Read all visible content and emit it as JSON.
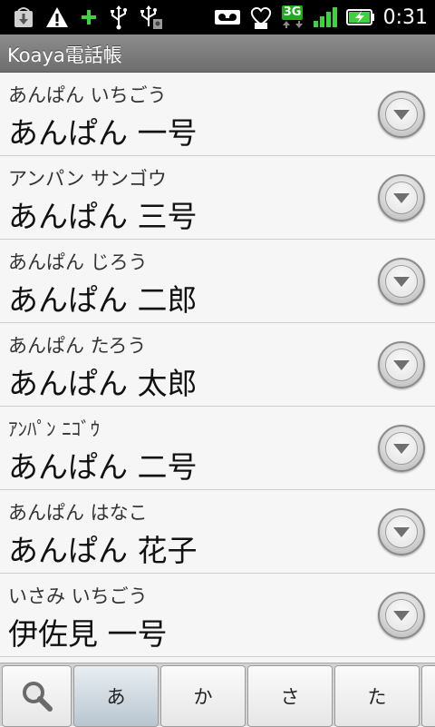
{
  "status_bar": {
    "left_icons": [
      "download-notification-icon",
      "warning-icon",
      "plus-icon",
      "usb-icon",
      "usb-debug-icon"
    ],
    "right_icons": [
      "voicemail-icon",
      "heart-notification-icon",
      "network-3g-icon",
      "signal-icon",
      "battery-charging-icon"
    ],
    "network_type": "3G",
    "time": "0:31"
  },
  "app": {
    "title": "Koaya電話帳"
  },
  "contacts": [
    {
      "reading": "あんぱん いちごう",
      "name": "あんぱん 一号"
    },
    {
      "reading": "アンパン サンゴウ",
      "name": "あんぱん 三号"
    },
    {
      "reading": "あんぱん じろう",
      "name": "あんぱん 二郎"
    },
    {
      "reading": "あんぱん たろう",
      "name": "あんぱん 太郎"
    },
    {
      "reading": "ｱﾝﾊﾟﾝ ﾆｺﾞｳ",
      "name": "あんぱん 二号"
    },
    {
      "reading": "あんぱん はなこ",
      "name": "あんぱん 花子"
    },
    {
      "reading": "いさみ いちごう",
      "name": "伊佐見 一号"
    }
  ],
  "index_bar": {
    "search_icon": "search-icon",
    "keys": [
      "あ",
      "か",
      "さ",
      "た"
    ],
    "selected_key": "あ"
  },
  "colors": {
    "status_bar_bg": "#000000",
    "title_bar_bg": "#7a7a7a",
    "list_bg": "#f6f6f6",
    "selected_key_bg": "#c3cfd7"
  }
}
